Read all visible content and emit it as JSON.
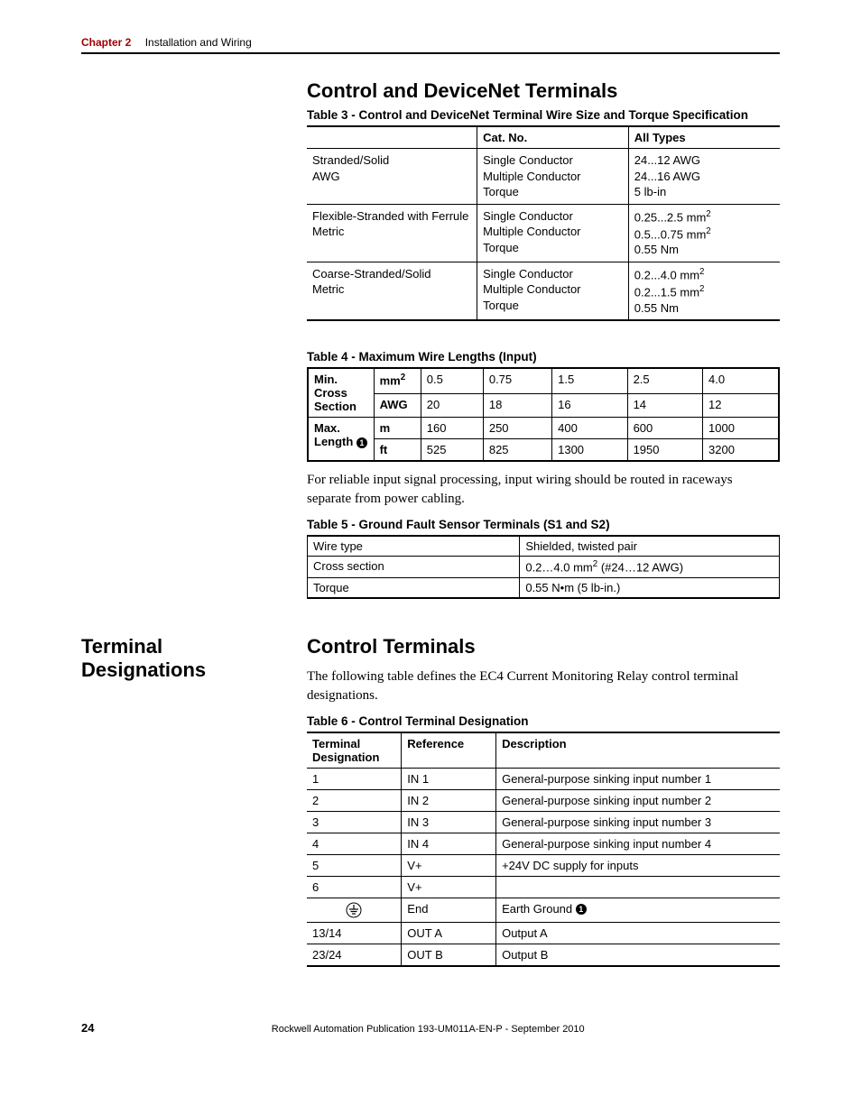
{
  "header": {
    "chapter": "Chapter 2",
    "title": "Installation and Wiring"
  },
  "section1": {
    "heading": "Control and DeviceNet Terminals",
    "table3_caption": "Table 3 - Control and DeviceNet Terminal Wire Size and Torque Specification",
    "t3": {
      "h_cat": "Cat. No.",
      "h_all": "All Types",
      "r1c1a": "Stranded/Solid",
      "r1c1b": "AWG",
      "r1c2a": "Single Conductor",
      "r1c2b": "Multiple Conductor",
      "r1c2c": "Torque",
      "r1c3a": "24...12 AWG",
      "r1c3b": "24...16 AWG",
      "r1c3c": "5 lb-in",
      "r2c1a": "Flexible-Stranded with Ferrule",
      "r2c1b": "Metric",
      "r2c2a": "Single Conductor",
      "r2c2b": "Multiple Conductor",
      "r2c2c": "Torque",
      "r2c3a": "0.25...2.5 mm",
      "r2c3b": "0.5...0.75 mm",
      "r2c3c": "0.55 Nm",
      "r3c1a": "Coarse-Stranded/Solid",
      "r3c1b": "Metric",
      "r3c2a": "Single Conductor",
      "r3c2b": "Multiple Conductor",
      "r3c2c": "Torque",
      "r3c3a": "0.2...4.0 mm",
      "r3c3b": "0.2...1.5 mm",
      "r3c3c": "0.55 Nm"
    },
    "table4_caption": "Table 4 - Maximum Wire Lengths (Input)",
    "t4": {
      "rh1": "Min. Cross Section",
      "rh2": "Max. Length ",
      "u1": "mm",
      "u2": "AWG",
      "u3": "m",
      "u4": "ft",
      "c": [
        "0.5",
        "0.75",
        "1.5",
        "2.5",
        "4.0"
      ],
      "awg": [
        "20",
        "18",
        "16",
        "14",
        "12"
      ],
      "m": [
        "160",
        "250",
        "400",
        "600",
        "1000"
      ],
      "ft": [
        "525",
        "825",
        "1300",
        "1950",
        "3200"
      ]
    },
    "paragraph1": "For reliable input signal processing, input wiring should be routed in raceways separate from power cabling.",
    "table5_caption": "Table 5 - Ground Fault Sensor Terminals (S1 and S2)",
    "t5": {
      "r1a": "Wire type",
      "r1b": "Shielded, twisted pair",
      "r2a": "Cross section",
      "r2b_pre": "0.2…4.0 mm",
      "r2b_post": " (#24…12 AWG)",
      "r3a": "Torque",
      "r3b": "0.55 N•m (5 lb-in.)"
    }
  },
  "section2": {
    "side_heading": "Terminal Designations",
    "heading": "Control Terminals",
    "paragraph2": "The following table defines the EC4 Current Monitoring Relay control terminal designations.",
    "table6_caption": "Table 6 - Control Terminal Designation",
    "t6": {
      "h1": "Terminal Designation",
      "h2": "Reference",
      "h3": "Description",
      "rows": [
        {
          "a": "1",
          "b": "IN 1",
          "c": "General-purpose sinking input number 1"
        },
        {
          "a": "2",
          "b": "IN 2",
          "c": "General-purpose sinking input number 2"
        },
        {
          "a": "3",
          "b": "IN 3",
          "c": "General-purpose sinking input number 3"
        },
        {
          "a": "4",
          "b": "IN 4",
          "c": "General-purpose sinking input number 4"
        },
        {
          "a": "5",
          "b": "V+",
          "c": "+24V DC supply for inputs"
        },
        {
          "a": "6",
          "b": "V+",
          "c": ""
        },
        {
          "a": "__GROUND__",
          "b": "End",
          "c": "Earth Ground "
        },
        {
          "a": "13/14",
          "b": "OUT A",
          "c": "Output A"
        },
        {
          "a": "23/24",
          "b": "OUT B",
          "c": "Output B"
        }
      ]
    }
  },
  "footer": {
    "page": "24",
    "pub": "Rockwell Automation Publication 193-UM011A-EN-P - September 2010"
  }
}
